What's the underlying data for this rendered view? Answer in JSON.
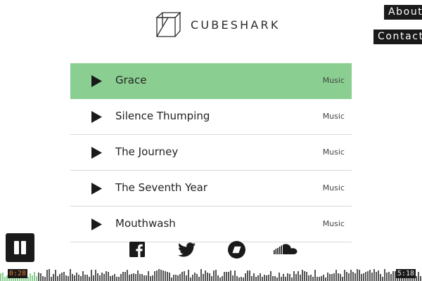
{
  "header": {
    "brand_name": "CUBESHARK",
    "logo_icon": "cube-logo"
  },
  "nav": {
    "about": "About",
    "contact": "Contact"
  },
  "tracks": [
    {
      "title": "Grace",
      "genre": "Music",
      "active": true
    },
    {
      "title": "Silence Thumping",
      "genre": "Music",
      "active": false
    },
    {
      "title": "The Journey",
      "genre": "Music",
      "active": false
    },
    {
      "title": "The Seventh Year",
      "genre": "Music",
      "active": false
    },
    {
      "title": "Mouthwash",
      "genre": "Music",
      "active": false
    }
  ],
  "social": [
    {
      "name": "facebook-icon"
    },
    {
      "name": "twitter-icon"
    },
    {
      "name": "bandcamp-icon"
    },
    {
      "name": "soundcloud-icon"
    }
  ],
  "player": {
    "state": "playing",
    "current_time": "0:28",
    "total_time": "5:18",
    "progress": 0.09
  },
  "colors": {
    "accent": "#8acf91",
    "dark": "#1a1a1a",
    "time_current": "#e07a2a"
  }
}
